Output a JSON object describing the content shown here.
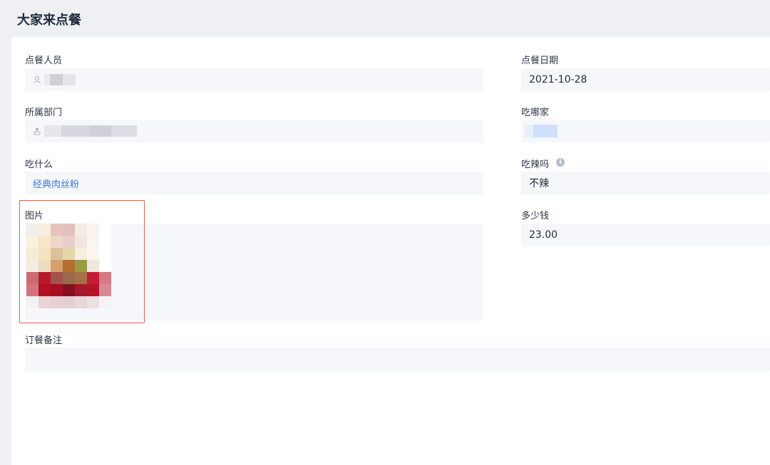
{
  "page": {
    "title": "大家来点餐"
  },
  "form": {
    "orderer": {
      "label": "点餐人员",
      "value_hidden": true,
      "icon": "user-icon"
    },
    "order_date": {
      "label": "点餐日期",
      "value": "2021-10-28"
    },
    "department": {
      "label": "所属部门",
      "value_hidden": true,
      "icon": "org-icon"
    },
    "restaurant": {
      "label": "吃哪家",
      "value_hidden": true
    },
    "dish": {
      "label": "吃什么",
      "value": "经典肉丝粉"
    },
    "spicy": {
      "label": "吃辣吗",
      "value": "不辣",
      "info_icon": "info-icon"
    },
    "photo": {
      "label": "图片"
    },
    "price": {
      "label": "多少钱",
      "value": "23.00"
    },
    "remark": {
      "label": "订餐备注",
      "value": ""
    }
  },
  "colors": {
    "background": "#eef0f4",
    "panel": "#ffffff",
    "field": "#f5f7fa",
    "link": "#3a7ad9",
    "highlight_border": "#e0604f"
  }
}
